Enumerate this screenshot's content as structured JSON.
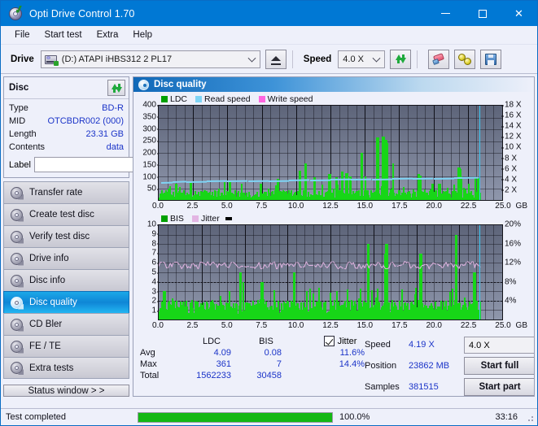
{
  "window": {
    "title": "Opti Drive Control 1.70",
    "icon": "disc-check-icon",
    "minimize": "–",
    "maximize": "□",
    "close": "✕"
  },
  "menu": {
    "items": [
      {
        "label": "File"
      },
      {
        "label": "Start test"
      },
      {
        "label": "Extra"
      },
      {
        "label": "Help"
      }
    ]
  },
  "toolbar": {
    "drive_label": "Drive",
    "drive_value": "(D:)  ATAPI iHBS312  2 PL17",
    "eject_icon": "eject-icon",
    "speed_label": "Speed",
    "speed_value": "4.0 X",
    "refresh_icon": "refresh-icon",
    "eraser_icon": "eraser-icon",
    "coins_icon": "gold-discs-icon",
    "save_icon": "save-floppy-icon"
  },
  "disc_panel": {
    "title": "Disc",
    "refresh_icon": "refresh-icon",
    "rows": [
      {
        "key": "Type",
        "value": "BD-R"
      },
      {
        "key": "MID",
        "value": "OTCBDR002 (000)"
      },
      {
        "key": "Length",
        "value": "23.31 GB"
      },
      {
        "key": "Contents",
        "value": "data"
      }
    ],
    "label_key": "Label",
    "label_value": "",
    "label_placeholder": "",
    "label_btn_icon": "disc-icon"
  },
  "sidebar": {
    "items": [
      {
        "label": "Transfer rate",
        "active": false
      },
      {
        "label": "Create test disc",
        "active": false
      },
      {
        "label": "Verify test disc",
        "active": false
      },
      {
        "label": "Drive info",
        "active": false
      },
      {
        "label": "Disc info",
        "active": false
      },
      {
        "label": "Disc quality",
        "active": true
      },
      {
        "label": "CD Bler",
        "active": false
      },
      {
        "label": "FE / TE",
        "active": false
      },
      {
        "label": "Extra tests",
        "active": false
      }
    ],
    "status_button": "Status window > >"
  },
  "content": {
    "header_title": "Disc quality",
    "header_icon": "disc-quality-icon"
  },
  "chart_data": [
    {
      "type": "bar",
      "name": "ldc-chart",
      "title": "",
      "legend": [
        {
          "label": "LDC",
          "color": "#17d617"
        },
        {
          "label": "Read speed",
          "color": "#7fd4f5"
        },
        {
          "label": "Write speed",
          "color": "#ff66e0"
        }
      ],
      "legend_position": "top-left",
      "xlabel": "GB",
      "x_ticks": [
        "0.0",
        "2.5",
        "5.0",
        "7.5",
        "10.0",
        "12.5",
        "15.0",
        "17.5",
        "20.0",
        "22.5",
        "25.0"
      ],
      "xlim": [
        0,
        25
      ],
      "ylabel_left": "LDC",
      "y_ticks_left": [
        "400",
        "350",
        "300",
        "250",
        "200",
        "150",
        "100",
        "50"
      ],
      "ylim_left": [
        0,
        400
      ],
      "ylabel_right": "Speed",
      "y_ticks_right": [
        "18 X",
        "16 X",
        "14 X",
        "12 X",
        "10 X",
        "8 X",
        "6 X",
        "4 X",
        "2 X"
      ],
      "ylim_right": [
        0,
        18
      ],
      "grid": true,
      "read_speed_curve": [
        {
          "x": 0.2,
          "y": 3.45
        },
        {
          "x": 1.0,
          "y": 3.5
        },
        {
          "x": 2.0,
          "y": 3.6
        },
        {
          "x": 3.5,
          "y": 3.65
        },
        {
          "x": 5.0,
          "y": 3.7
        },
        {
          "x": 6.5,
          "y": 3.75
        },
        {
          "x": 8.0,
          "y": 3.8
        },
        {
          "x": 9.5,
          "y": 3.85
        },
        {
          "x": 11.0,
          "y": 3.95
        },
        {
          "x": 12.5,
          "y": 4.0
        },
        {
          "x": 14.0,
          "y": 4.05
        },
        {
          "x": 15.5,
          "y": 4.1
        },
        {
          "x": 17.0,
          "y": 4.15
        },
        {
          "x": 18.5,
          "y": 4.2
        },
        {
          "x": 20.0,
          "y": 4.25
        },
        {
          "x": 21.5,
          "y": 4.3
        },
        {
          "x": 23.3,
          "y": 4.35
        }
      ],
      "cursor_x": 23.35
    },
    {
      "type": "bar",
      "name": "bis-chart",
      "title": "",
      "legend": [
        {
          "label": "BIS",
          "color": "#17d617"
        },
        {
          "label": "Jitter",
          "color": "#e3b5e3"
        }
      ],
      "legend_position": "top-left",
      "xlabel": "GB",
      "x_ticks": [
        "0.0",
        "2.5",
        "5.0",
        "7.5",
        "10.0",
        "12.5",
        "15.0",
        "17.5",
        "20.0",
        "22.5",
        "25.0"
      ],
      "xlim": [
        0,
        25
      ],
      "ylabel_left": "BIS",
      "y_ticks_left": [
        "10",
        "9",
        "8",
        "7",
        "6",
        "5",
        "4",
        "3",
        "2",
        "1"
      ],
      "ylim_left": [
        0,
        10
      ],
      "ylabel_right": "Jitter",
      "y_ticks_right": [
        "20%",
        "16%",
        "12%",
        "8%",
        "4%"
      ],
      "ylim_right": [
        0,
        20
      ],
      "grid": true,
      "jitter_mean_pct": 11.6,
      "cursor_x": 23.35
    }
  ],
  "stats": {
    "col_headers": {
      "ldc": "LDC",
      "bis": "BIS",
      "jitter": "Jitter"
    },
    "jitter_checked": true,
    "rows": [
      {
        "key": "Avg",
        "ldc": "4.09",
        "bis": "0.08",
        "jitter": "11.6%"
      },
      {
        "key": "Max",
        "ldc": "361",
        "bis": "7",
        "jitter": "14.4%"
      },
      {
        "key": "Total",
        "ldc": "1562233",
        "bis": "30458",
        "jitter": ""
      }
    ],
    "right": [
      {
        "key": "Speed",
        "value": "4.19 X"
      },
      {
        "key": "Position",
        "value": "23862 MB"
      },
      {
        "key": "Samples",
        "value": "381515"
      }
    ],
    "speed_select": "4.0 X",
    "start_full": "Start full",
    "start_part": "Start part"
  },
  "statusbar": {
    "text": "Test completed",
    "progress_pct": 100,
    "progress_label": "100.0%",
    "elapsed": "33:16"
  }
}
